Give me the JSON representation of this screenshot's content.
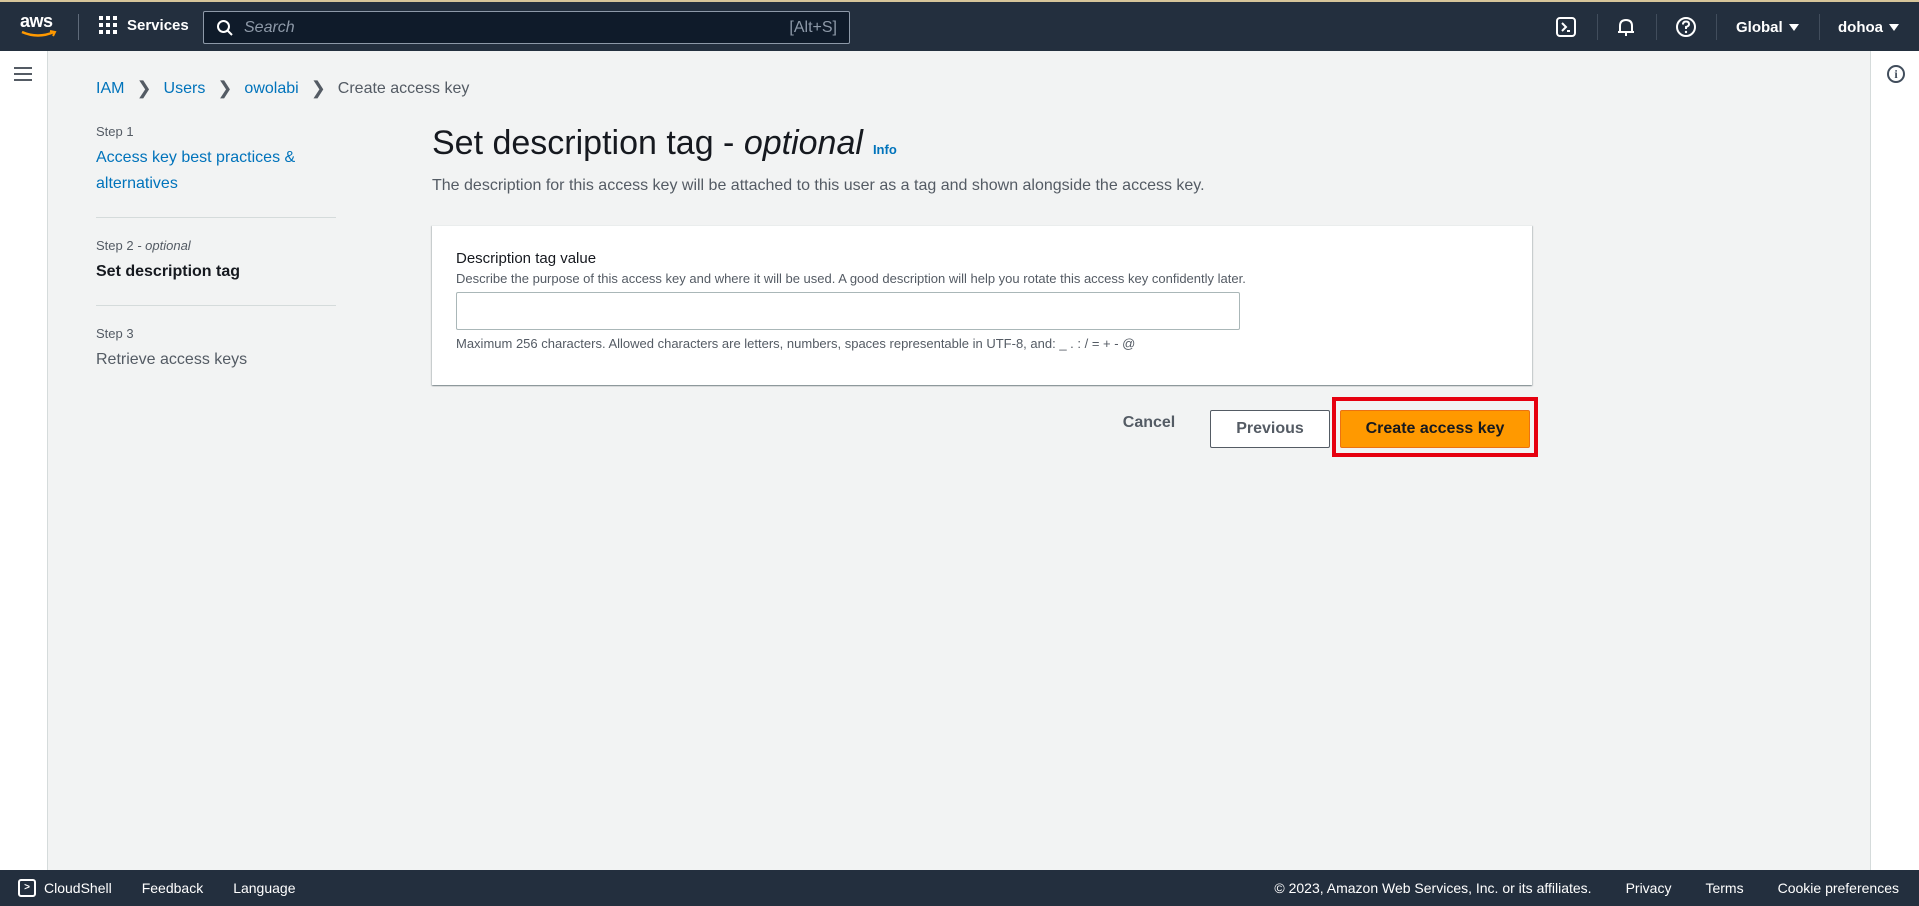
{
  "topnav": {
    "logo_text": "aws",
    "services_label": "Services",
    "search_placeholder": "Search",
    "search_shortcut": "[Alt+S]",
    "region_label": "Global",
    "user_label": "dohoa"
  },
  "breadcrumb": {
    "items": [
      "IAM",
      "Users",
      "owolabi"
    ],
    "current": "Create access key"
  },
  "steps": [
    {
      "num": "Step 1",
      "title": "Access key best practices & alternatives"
    },
    {
      "num": "Step 2",
      "optional": " - optional",
      "title": "Set description tag"
    },
    {
      "num": "Step 3",
      "title": "Retrieve access keys"
    }
  ],
  "main": {
    "title_prefix": "Set description tag - ",
    "title_optional": "optional",
    "info_link": "Info",
    "description": "The description for this access key will be attached to this user as a tag and shown alongside the access key."
  },
  "form": {
    "label": "Description tag value",
    "description": "Describe the purpose of this access key and where it will be used. A good description will help you rotate this access key confidently later.",
    "value": "",
    "constraint": "Maximum 256 characters. Allowed characters are letters, numbers, spaces representable in UTF-8, and: _ . : / = + - @"
  },
  "actions": {
    "cancel": "Cancel",
    "previous": "Previous",
    "create": "Create access key"
  },
  "footer": {
    "cloudshell": "CloudShell",
    "feedback": "Feedback",
    "language": "Language",
    "copyright": "© 2023, Amazon Web Services, Inc. or its affiliates.",
    "privacy": "Privacy",
    "terms": "Terms",
    "cookies": "Cookie preferences"
  },
  "colors": {
    "nav_bg": "#232f3e",
    "link": "#0073bb",
    "primary": "#ff9900",
    "highlight": "#e6000f"
  }
}
